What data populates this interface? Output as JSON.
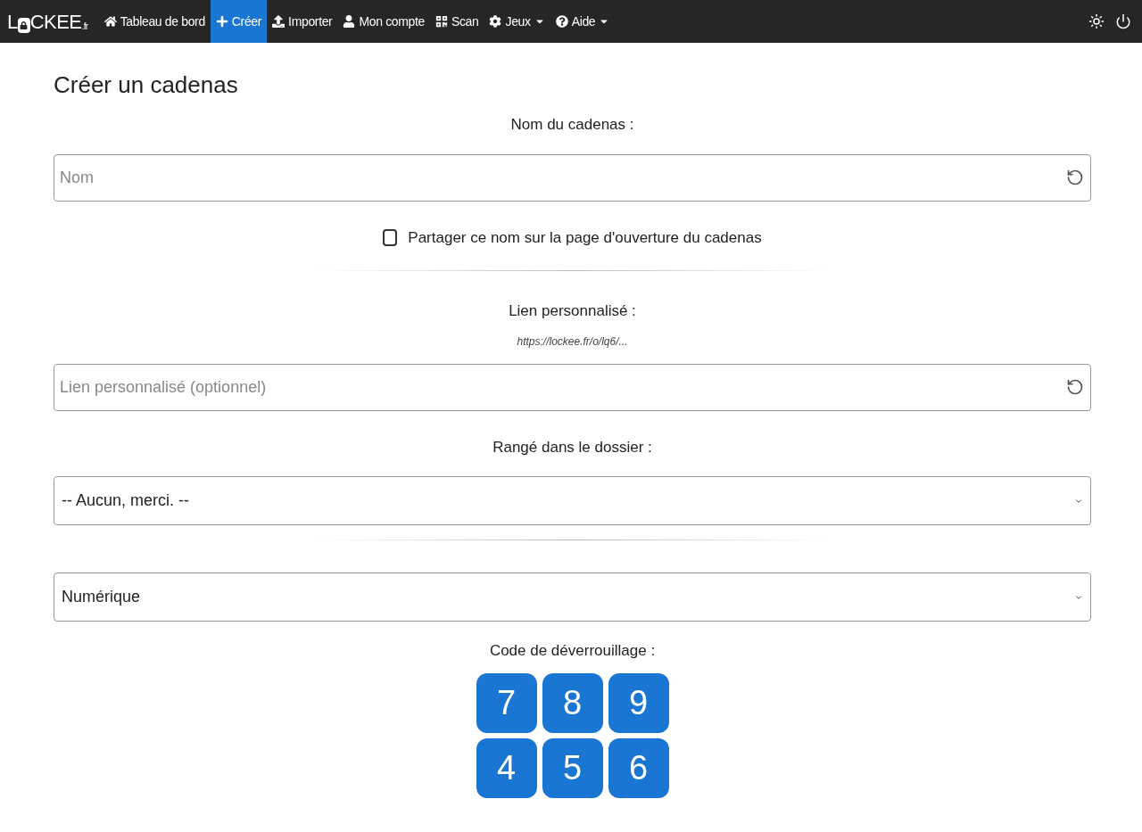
{
  "navbar": {
    "logo": {
      "before": "L",
      "after": "CKEE",
      "suffix": ".fr"
    },
    "items": [
      {
        "label": "Tableau de bord",
        "selected": false,
        "dropdown": false
      },
      {
        "label": "Créer",
        "selected": true,
        "dropdown": false
      },
      {
        "label": "Importer",
        "selected": false,
        "dropdown": false
      },
      {
        "label": "Mon compte",
        "selected": false,
        "dropdown": false
      },
      {
        "label": "Scan",
        "selected": false,
        "dropdown": false
      },
      {
        "label": "Jeux",
        "selected": false,
        "dropdown": true
      },
      {
        "label": "Aide",
        "selected": false,
        "dropdown": true
      }
    ]
  },
  "title": "Créer un cadenas",
  "name_field": {
    "label": "Nom du cadenas :",
    "placeholder": "Nom"
  },
  "share_checkbox": {
    "label": "Partager ce nom sur la page d'ouverture du cadenas",
    "checked": false
  },
  "link_field": {
    "label": "Lien personnalisé :",
    "hint": "https://lockee.fr/o/lq6/...",
    "placeholder": "Lien personnalisé (optionnel)"
  },
  "folder_select": {
    "label": "Rangé dans le dossier :",
    "value": "-- Aucun, merci. --"
  },
  "type_select": {
    "value": "Numérique"
  },
  "code": {
    "label": "Code de déverrouillage :",
    "keys": [
      "7",
      "8",
      "9",
      "4",
      "5",
      "6"
    ]
  }
}
